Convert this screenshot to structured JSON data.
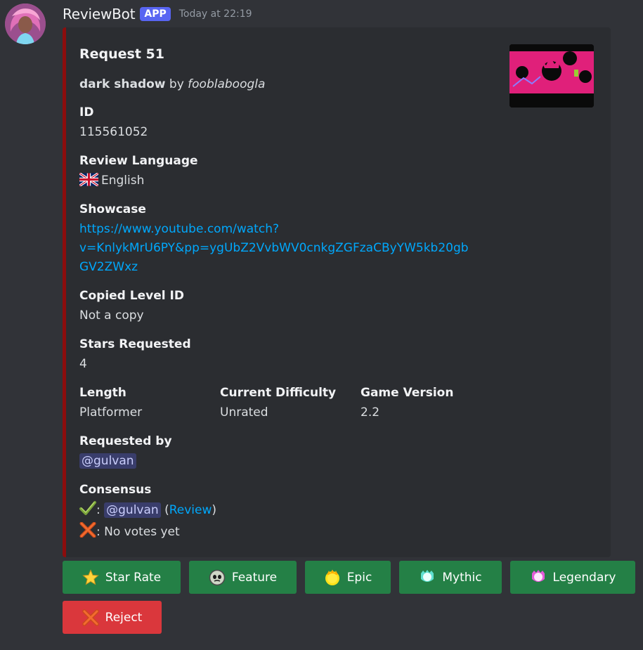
{
  "header": {
    "username": "ReviewBot",
    "badge": "APP",
    "timestamp": "Today at 22:19"
  },
  "embed": {
    "accent_color": "#8c0d0d",
    "title": "Request 51",
    "level_name": "dark shadow",
    "by_text": "by",
    "author": "fooblaboogla",
    "fields": {
      "id": {
        "name": "ID",
        "value": "115561052"
      },
      "language": {
        "name": "Review Language",
        "flag": "uk-flag-icon",
        "value": "English"
      },
      "showcase": {
        "name": "Showcase",
        "line1": "https://www.youtube.com/watch?",
        "line2": "v=KnlykMrU6PY&pp=ygUbZ2VvbWV0cnkgZGFzaCByYW5kb20gb",
        "line3": "GV2ZWxz"
      },
      "copied": {
        "name": "Copied Level ID",
        "value": "Not a copy"
      },
      "stars": {
        "name": "Stars Requested",
        "value": "4"
      },
      "length": {
        "name": "Length",
        "value": "Platformer"
      },
      "difficulty": {
        "name": "Current Difficulty",
        "value": "Unrated"
      },
      "version": {
        "name": "Game Version",
        "value": "2.2"
      },
      "requested_by": {
        "name": "Requested by",
        "value": "@gulvan"
      },
      "consensus": {
        "name": "Consensus",
        "yes_mention": "@gulvan",
        "review_open": "(",
        "review_label": "Review",
        "review_close": ")",
        "no_text": ": No votes yet"
      }
    }
  },
  "buttons": {
    "star_rate": "Star Rate",
    "feature": "Feature",
    "epic": "Epic",
    "mythic": "Mythic",
    "legendary": "Legendary",
    "reject": "Reject"
  },
  "colors": {
    "background": "#313338",
    "embed_bg": "#2b2d31",
    "success": "#248046",
    "danger": "#da373c",
    "link": "#00a8fc",
    "badge": "#5865f2"
  }
}
